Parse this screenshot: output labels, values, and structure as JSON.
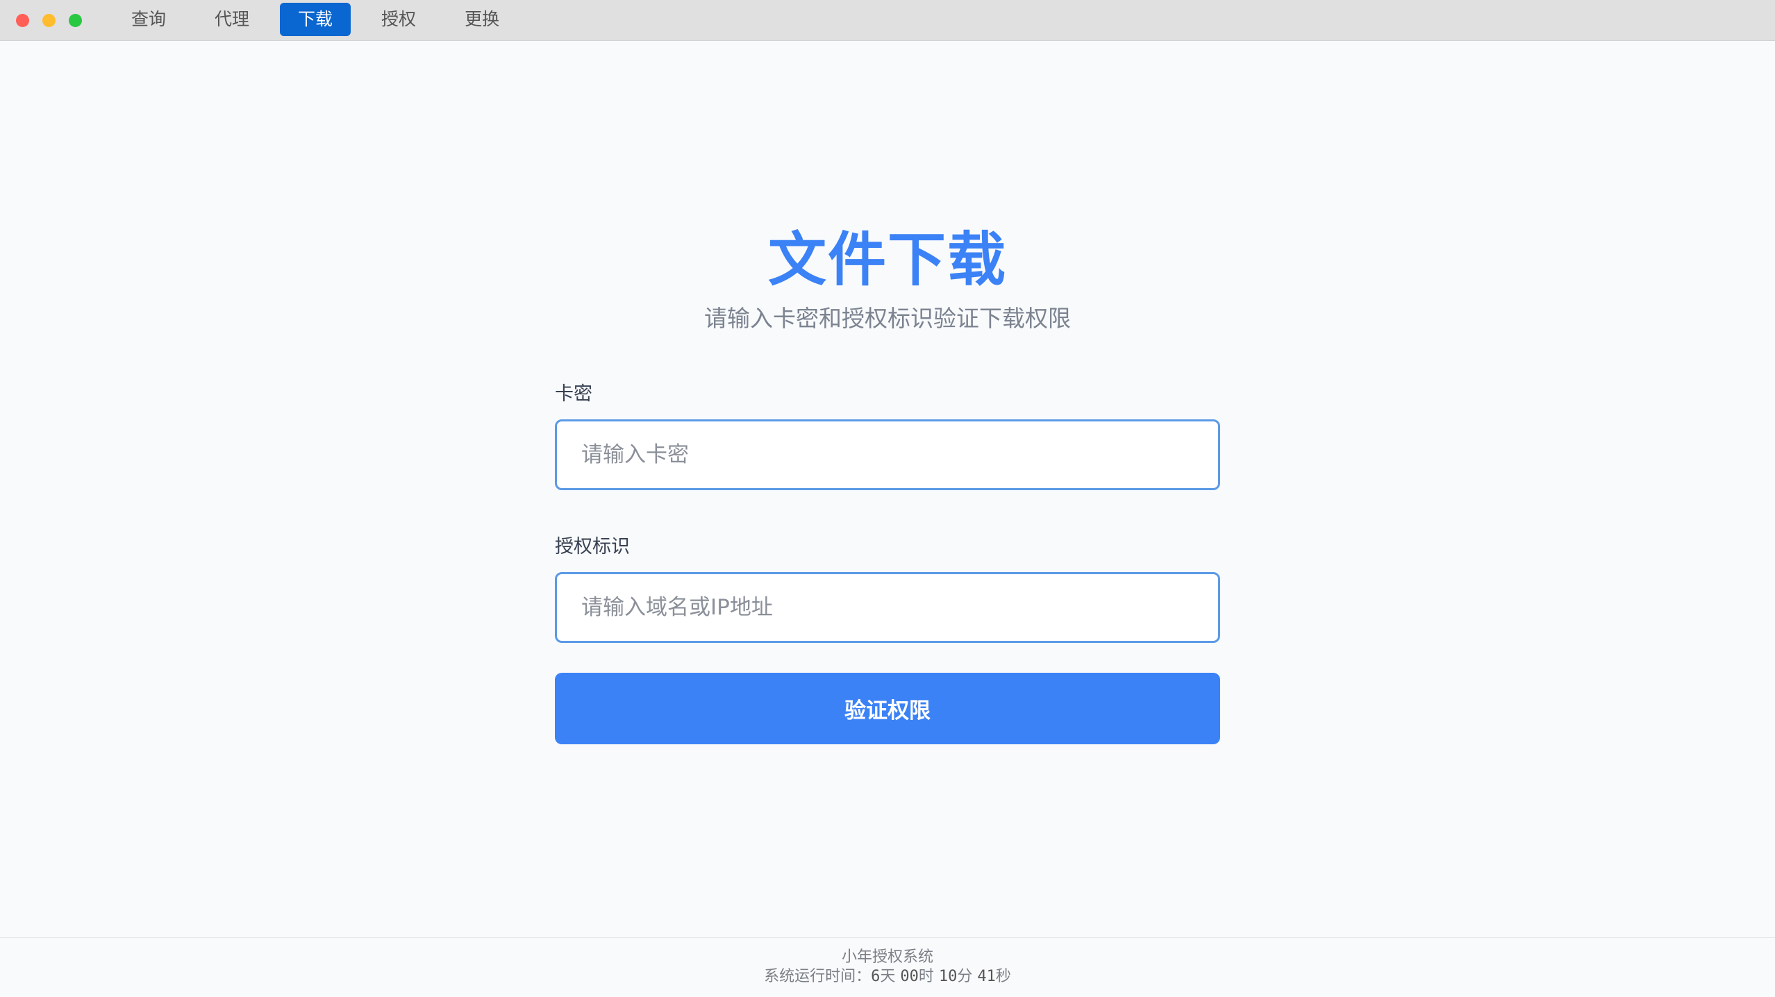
{
  "titlebar": {
    "tabs": [
      {
        "label": "查询",
        "active": false
      },
      {
        "label": "代理",
        "active": false
      },
      {
        "label": "下载",
        "active": true
      },
      {
        "label": "授权",
        "active": false
      },
      {
        "label": "更换",
        "active": false
      }
    ]
  },
  "colors": {
    "accent": "#3b82f6",
    "active_tab": "#0a66d0",
    "close": "#ff5f57",
    "minimize": "#febc2e",
    "maximize": "#28c840"
  },
  "main": {
    "title": "文件下载",
    "subtitle": "请输入卡密和授权标识验证下载权限",
    "card_key": {
      "label": "卡密",
      "placeholder": "请输入卡密",
      "value": ""
    },
    "auth_id": {
      "label": "授权标识",
      "placeholder": "请输入域名或IP地址",
      "value": ""
    },
    "submit_label": "验证权限"
  },
  "footer": {
    "system_name": "小年授权系统",
    "runtime_prefix": "系统运行时间：",
    "days": "6",
    "days_unit": "天",
    "hours": "00",
    "hours_unit": "时",
    "minutes": "10",
    "minutes_unit": "分",
    "seconds": "41",
    "seconds_unit": "秒"
  }
}
